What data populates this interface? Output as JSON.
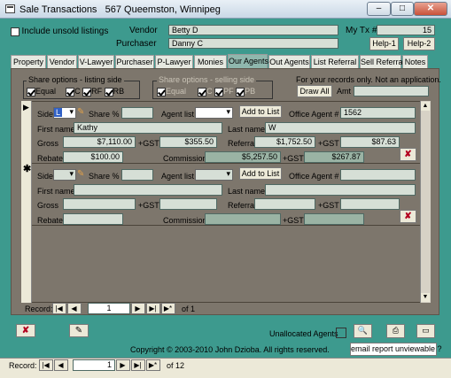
{
  "window": {
    "title": "Sale Transactions",
    "subtitle": "567 Queemston, Winnipeg",
    "min_glyph": "–",
    "max_glyph": "□",
    "close_glyph": "✕"
  },
  "header": {
    "include_unsold_label": "Include unsold listings",
    "vendor_label": "Vendor",
    "vendor_value": "Betty D",
    "purchaser_label": "Purchaser",
    "purchaser_value": "Danny C",
    "mytx_label": "My Tx #",
    "mytx_value": "15",
    "help1": "Help-1",
    "help2": "Help-2"
  },
  "tabs": [
    {
      "label": "Property"
    },
    {
      "label": "Vendor"
    },
    {
      "label": "V-Lawyer"
    },
    {
      "label": "Purchaser"
    },
    {
      "label": "P-Lawyer"
    },
    {
      "label": "Monies"
    },
    {
      "label": "Our Agents"
    },
    {
      "label": "Out Agents"
    },
    {
      "label": "List Referral"
    },
    {
      "label": "Sell Referral"
    },
    {
      "label": "Notes"
    }
  ],
  "share_listing": {
    "title": "Share options - listing side",
    "equal": "Equal",
    "c": "C",
    "rf": "RF",
    "rb": "RB"
  },
  "share_selling": {
    "title": "Share options - selling side",
    "equal": "Equal",
    "c": "C",
    "pf": "PF",
    "pb": "PB"
  },
  "records_note": "For your records only. Not an application.",
  "draw_all": "Draw All",
  "amt_label": "Amt",
  "labels": {
    "side": "Side",
    "share_pct": "Share %",
    "agent_list": "Agent list",
    "add_to_list": "Add to List",
    "office_agent": "Office Agent #",
    "first_name": "First name",
    "last_name": "Last name",
    "gross": "Gross",
    "gst": "+GST",
    "referral": "Referral",
    "rebate": "Rebate",
    "commission": "Commission"
  },
  "record1": {
    "side": "L",
    "office_agent": "1562",
    "first_name": "Kathy",
    "last_name": "W",
    "gross": "$7,110.00",
    "gross_gst": "$355.50",
    "referral": "$1,752.50",
    "referral_gst": "$87.63",
    "rebate": "$100.00",
    "commission": "$5,257.50",
    "commission_gst": "$267.87"
  },
  "subnav": {
    "label": "Record:",
    "current": "1",
    "of": "of",
    "total": "1"
  },
  "footer": {
    "unallocated": "Unallocated Agents",
    "copyright": "Copyright © 2003-2010 John Dzioba. All rights reserved.",
    "email_btn": "email report unviewable ?"
  },
  "mainnav": {
    "label": "Record:",
    "current": "1",
    "of": "of",
    "total": "12"
  },
  "nav_glyphs": {
    "first": "|◀",
    "prev": "◀",
    "next": "▶",
    "last": "▶|",
    "new": "▶*"
  },
  "colors": {
    "background": "#3d9a8e",
    "subform": "#7d766c",
    "field": "#d6dfd6",
    "delete_icon": "#b3001f"
  },
  "icons": {
    "delete": "delete-icon",
    "edit": "edit-icon",
    "preview": "print-preview-icon",
    "print": "printer-icon",
    "export": "export-icon"
  }
}
